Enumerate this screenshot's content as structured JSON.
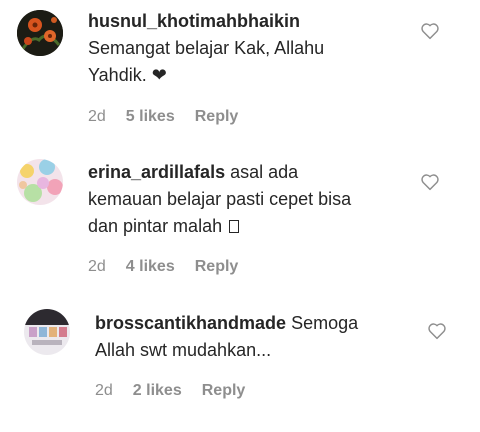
{
  "comments": [
    {
      "username": "husnul_khotimahbhaikin",
      "line1": "Semangat belajar Kak, Allahu",
      "line2": "Yahdik. ❤",
      "age": "2d",
      "likes": "5 likes",
      "reply": "Reply"
    },
    {
      "username": "erina_ardillafals",
      "line1_rest": " asal ada",
      "line2": "kemauan belajar pasti cepet bisa",
      "line3": "dan pintar malah",
      "age": "2d",
      "likes": "4 likes",
      "reply": "Reply"
    },
    {
      "username": "brosscantikhandmade",
      "line1_rest": " Semoga",
      "line2": "Allah swt mudahkan...",
      "age": "2d",
      "likes": "2 likes",
      "reply": "Reply"
    }
  ],
  "colors": {
    "text": "#262626",
    "meta": "#8e8e8e",
    "icon": "#8e8e8e"
  }
}
